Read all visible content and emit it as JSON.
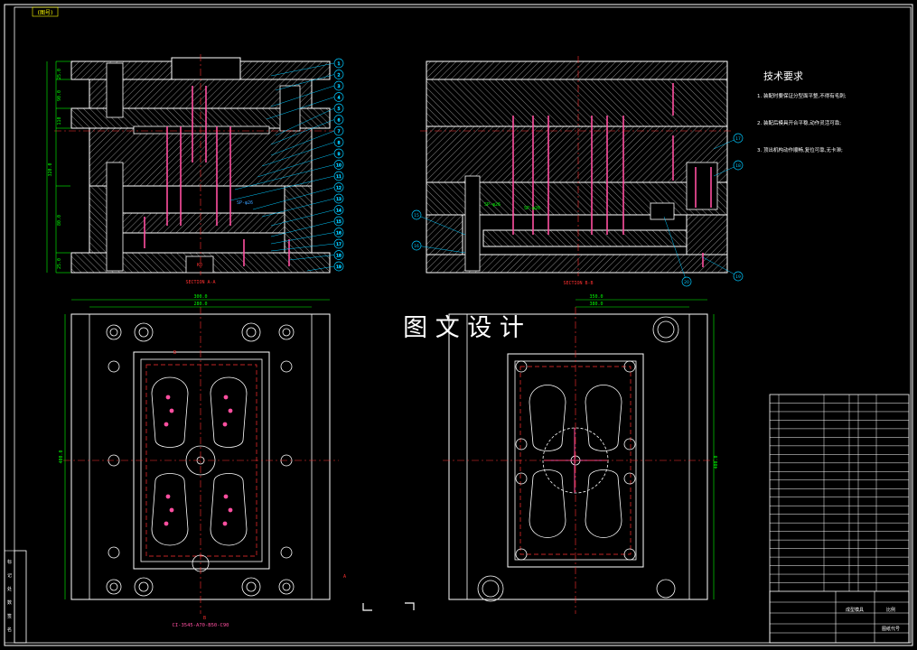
{
  "colors": {
    "background": "#000000",
    "frame": "#ffffff",
    "outline": "#ffffff",
    "hatch": "#b9b9b9",
    "dimension": "#00ff00",
    "centerline": "#ff3030",
    "pins": "#ff4fa0",
    "callout": "#00c8ff",
    "text_red": "#ff3030",
    "text_blue": "#3aa0ff"
  },
  "corner_tag": "(图号)",
  "watermark": "图 文 设 计",
  "section_a_label": "SECTION A-A",
  "section_b_label": "SECTION B-B",
  "requirements": {
    "title": "技术要求",
    "items": [
      "1. 装配时要保证分型面平整,不得有毛刺;",
      "2. 装配后模具开合平稳,动作灵活可靠;",
      "3. 顶出机构动作顺畅,复位可靠,无卡滞;"
    ]
  },
  "dims_top_left": [
    "25.0",
    "90.0",
    "110",
    "320.0",
    "80.0",
    "25.0"
  ],
  "dims_plan": [
    "300.0",
    "280.0",
    "400.0"
  ],
  "dims_plan_right": [
    "350.0",
    "380.0",
    "400.0"
  ],
  "plan_bottom_label": "CI-3545-A70-B50-C90",
  "spec_labels": [
    "SP-φ26",
    "SP-φ26",
    "SP-φ26"
  ],
  "section_marks": [
    "A",
    "A",
    "B",
    "B"
  ],
  "callouts_left": [
    "1",
    "2",
    "3",
    "4",
    "5",
    "6",
    "7",
    "8",
    "9",
    "10",
    "11",
    "12",
    "13",
    "14",
    "15",
    "16",
    "17",
    "18",
    "19"
  ],
  "callouts_right": [
    "15",
    "16",
    "17",
    "18",
    "19",
    "20"
  ],
  "title_block": {
    "rows": 23,
    "drawing_name": "成型模具",
    "scale_label": "比例",
    "company": "图纸代号"
  },
  "revision_labels": [
    "标",
    "记",
    "处",
    "数",
    "签",
    "名"
  ]
}
